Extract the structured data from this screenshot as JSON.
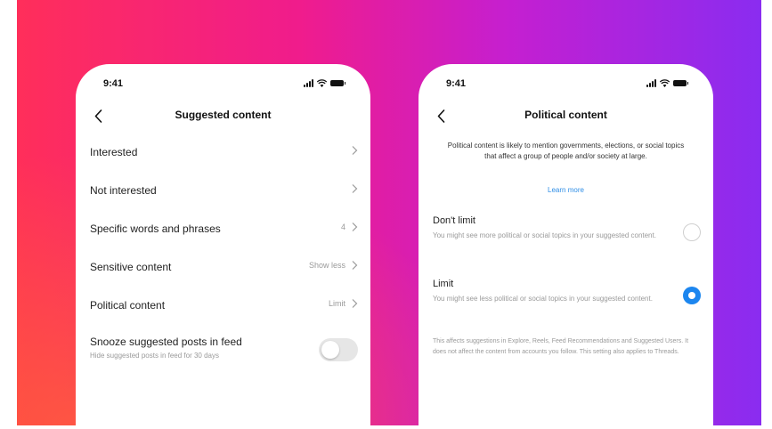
{
  "colors": {
    "accent_blue": "#1c86ef",
    "link_blue": "#2f8ee6",
    "gradient": [
      "#ff2e5a",
      "#f01c8c",
      "#c51fd0",
      "#8a2cf0"
    ]
  },
  "left_phone": {
    "status": {
      "time": "9:41"
    },
    "header": {
      "title": "Suggested content",
      "back_icon": "chevron-left-icon"
    },
    "items": [
      {
        "label": "Interested",
        "value": ""
      },
      {
        "label": "Not interested",
        "value": ""
      },
      {
        "label": "Specific words and phrases",
        "value": "4"
      },
      {
        "label": "Sensitive content",
        "value": "Show less"
      },
      {
        "label": "Political content",
        "value": "Limit"
      }
    ],
    "toggle": {
      "label": "Snooze suggested posts in feed",
      "description": "Hide suggested posts in feed for 30 days",
      "on": false
    }
  },
  "right_phone": {
    "status": {
      "time": "9:41"
    },
    "header": {
      "title": "Political content",
      "back_icon": "chevron-left-icon"
    },
    "intro": "Political content is likely to mention governments, elections, or social topics that affect a group of people and/or society at large.",
    "learn_more": "Learn more",
    "options": [
      {
        "title": "Don't limit",
        "description": "You might see more political or social topics in your suggested content.",
        "selected": false
      },
      {
        "title": "Limit",
        "description": "You might see less political or social topics in your suggested content.",
        "selected": true
      }
    ],
    "footnote": "This affects suggestions in Explore, Reels, Feed Recommendations and Suggested Users. It does not affect the content from accounts you follow. This setting also applies to Threads."
  }
}
